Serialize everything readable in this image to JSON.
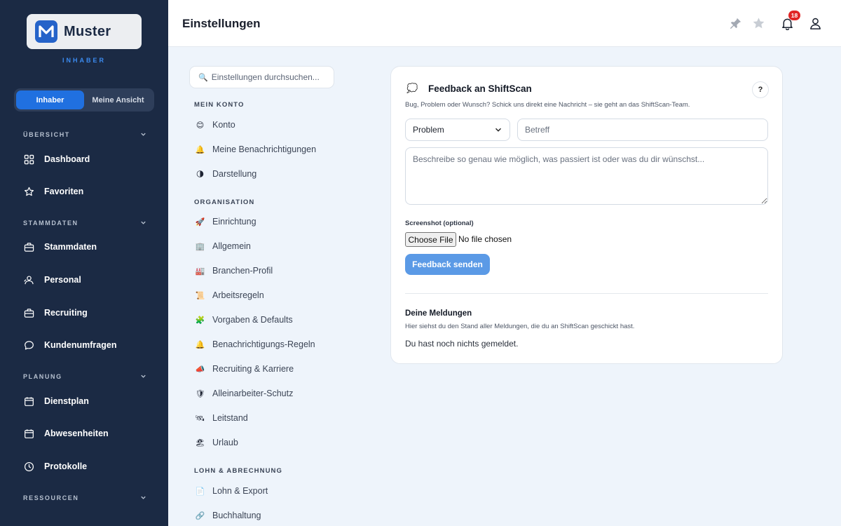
{
  "brand": {
    "name": "Muster",
    "logo_letter": "M",
    "role_caption": "INHABER",
    "accent": "#2563c9"
  },
  "role_toggle": {
    "options": [
      "Inhaber",
      "Meine Ansicht"
    ],
    "active": "Inhaber"
  },
  "sidebar": {
    "sections": [
      {
        "label": "ÜBERSICHT",
        "items": [
          {
            "label": "Dashboard",
            "icon": "grid-icon"
          },
          {
            "label": "Favoriten",
            "icon": "star-icon"
          }
        ]
      },
      {
        "label": "STAMMDATEN",
        "items": [
          {
            "label": "Stammdaten",
            "icon": "briefcase-icon"
          },
          {
            "label": "Personal",
            "icon": "people-icon"
          },
          {
            "label": "Recruiting",
            "icon": "briefcase-icon"
          },
          {
            "label": "Kundenumfragen",
            "icon": "chat-icon"
          }
        ]
      },
      {
        "label": "PLANUNG",
        "items": [
          {
            "label": "Dienstplan",
            "icon": "calendar-icon"
          },
          {
            "label": "Abwesenheiten",
            "icon": "calendar-icon"
          },
          {
            "label": "Protokolle",
            "icon": "clock-icon"
          }
        ]
      },
      {
        "label": "RESSOURCEN",
        "items": []
      }
    ]
  },
  "header": {
    "title": "Einstellungen",
    "notification_count": "18",
    "icons": [
      "pin-icon",
      "star-icon",
      "bell-icon",
      "user-icon"
    ]
  },
  "settings_nav": {
    "search_placeholder": "Einstellungen durchsuchen...",
    "groups": [
      {
        "label": "MEIN KONTO",
        "items": [
          {
            "label": "Konto",
            "emoji": "😊"
          },
          {
            "label": "Meine Benachrichtigungen",
            "emoji": "🔔"
          },
          {
            "label": "Darstellung",
            "emoji": "🌗"
          }
        ]
      },
      {
        "label": "ORGANISATION",
        "items": [
          {
            "label": "Einrichtung",
            "emoji": "🚀"
          },
          {
            "label": "Allgemein",
            "emoji": "🏢"
          },
          {
            "label": "Branchen-Profil",
            "emoji": "🏭"
          },
          {
            "label": "Arbeitsregeln",
            "emoji": "📜"
          },
          {
            "label": "Vorgaben & Defaults",
            "emoji": "🧩"
          },
          {
            "label": "Benachrichtigungs-Regeln",
            "emoji": "🔔"
          },
          {
            "label": "Recruiting & Karriere",
            "emoji": "📣"
          },
          {
            "label": "Alleinarbeiter-Schutz",
            "emoji": "🛡"
          },
          {
            "label": "Leitstand",
            "emoji": "🛰"
          },
          {
            "label": "Urlaub",
            "emoji": "🏖"
          }
        ]
      },
      {
        "label": "LOHN & ABRECHNUNG",
        "items": [
          {
            "label": "Lohn & Export",
            "emoji": "📄"
          },
          {
            "label": "Buchhaltung",
            "emoji": "🔗"
          }
        ]
      }
    ]
  },
  "feedback": {
    "emoji": "💭",
    "title": "Feedback an ShiftScan",
    "help": "?",
    "subtitle": "Bug, Problem oder Wunsch? Schick uns direkt eine Nachricht – sie geht an das ShiftScan-Team.",
    "type_value": "Problem",
    "subject_placeholder": "Betreff",
    "description_placeholder": "Beschreibe so genau wie möglich, was passiert ist oder was du dir wünschst...",
    "screenshot_label": "Screenshot (optional)",
    "file_button": "Choose File",
    "file_status": "No file chosen",
    "submit": "Feedback senden",
    "submit_color": "#5b9ae6",
    "reports_title": "Deine Meldungen",
    "reports_subtitle": "Hier siehst du den Stand aller Meldungen, die du an ShiftScan geschickt hast.",
    "reports_empty": "Du hast noch nichts gemeldet."
  }
}
